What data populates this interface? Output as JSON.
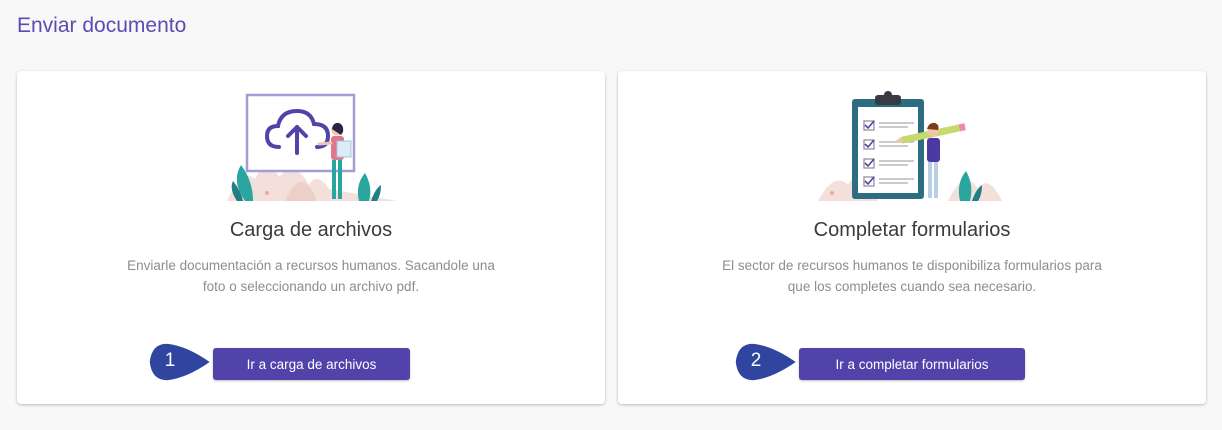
{
  "page": {
    "title": "Enviar documento"
  },
  "cards": [
    {
      "title": "Carga de archivos",
      "description": "Enviarle documentación a recursos humanos. Sacandole una foto o seleccionando un archivo pdf.",
      "button_label": "Ir a carga de archivos",
      "step_number": "1",
      "illustration": "cloud-upload-icon"
    },
    {
      "title": "Completar formularios",
      "description": "El sector de recursos humanos te disponibiliza formularios para que los completes cuando sea necesario.",
      "button_label": "Ir a completar formularios",
      "step_number": "2",
      "illustration": "clipboard-checklist-icon"
    }
  ],
  "colors": {
    "accent": "#5243aa",
    "title": "#5a4cb0",
    "marker": "#2f45a0",
    "teal": "#2aa5a0",
    "background": "#f8f8f9"
  }
}
